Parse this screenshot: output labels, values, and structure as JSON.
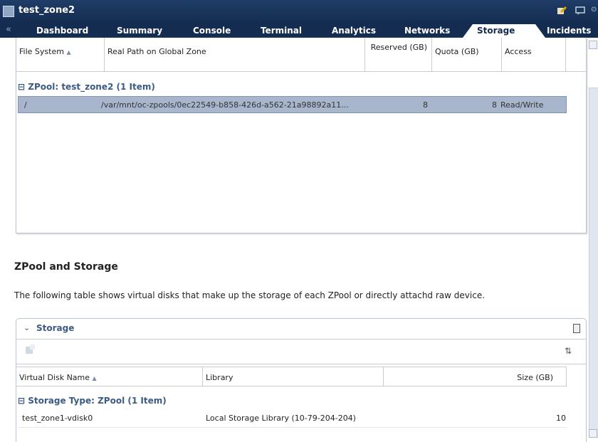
{
  "window": {
    "title": "test_zone2"
  },
  "tabs": [
    {
      "label": "Dashboard"
    },
    {
      "label": "Summary"
    },
    {
      "label": "Console"
    },
    {
      "label": "Terminal"
    },
    {
      "label": "Analytics"
    },
    {
      "label": "Networks"
    },
    {
      "label": "Storage",
      "active": true
    },
    {
      "label": "Incidents"
    }
  ],
  "fs_table": {
    "columns": [
      "File System",
      "Real Path on Global Zone",
      "Reserved (GB)",
      "Quota (GB)",
      "Access"
    ],
    "group_label": "ZPool: test_zone2 (1 Item)",
    "rows": [
      {
        "file_system": "/",
        "real_path": "/var/mnt/oc-zpools/0ec22549-b858-426d-a562-21a98892a11...",
        "reserved": "8",
        "quota": "8",
        "access": "Read/Write"
      }
    ]
  },
  "section": {
    "title": "ZPool and Storage",
    "description": "The following table shows virtual disks that make up the storage of each ZPool or directly attachd raw device."
  },
  "storage_panel": {
    "title": "Storage",
    "columns": [
      "Virtual Disk Name",
      "Library",
      "Size (GB)"
    ],
    "group_label": "Storage Type: ZPool (1 Item)",
    "rows": [
      {
        "name": "test_zone1-vdisk0",
        "library": "Local Storage Library (10-79-204-204)",
        "size": "10"
      }
    ]
  },
  "colors": {
    "accent": "#142c50",
    "link": "#3b5b85",
    "selected_row": "#a7b6cc"
  }
}
